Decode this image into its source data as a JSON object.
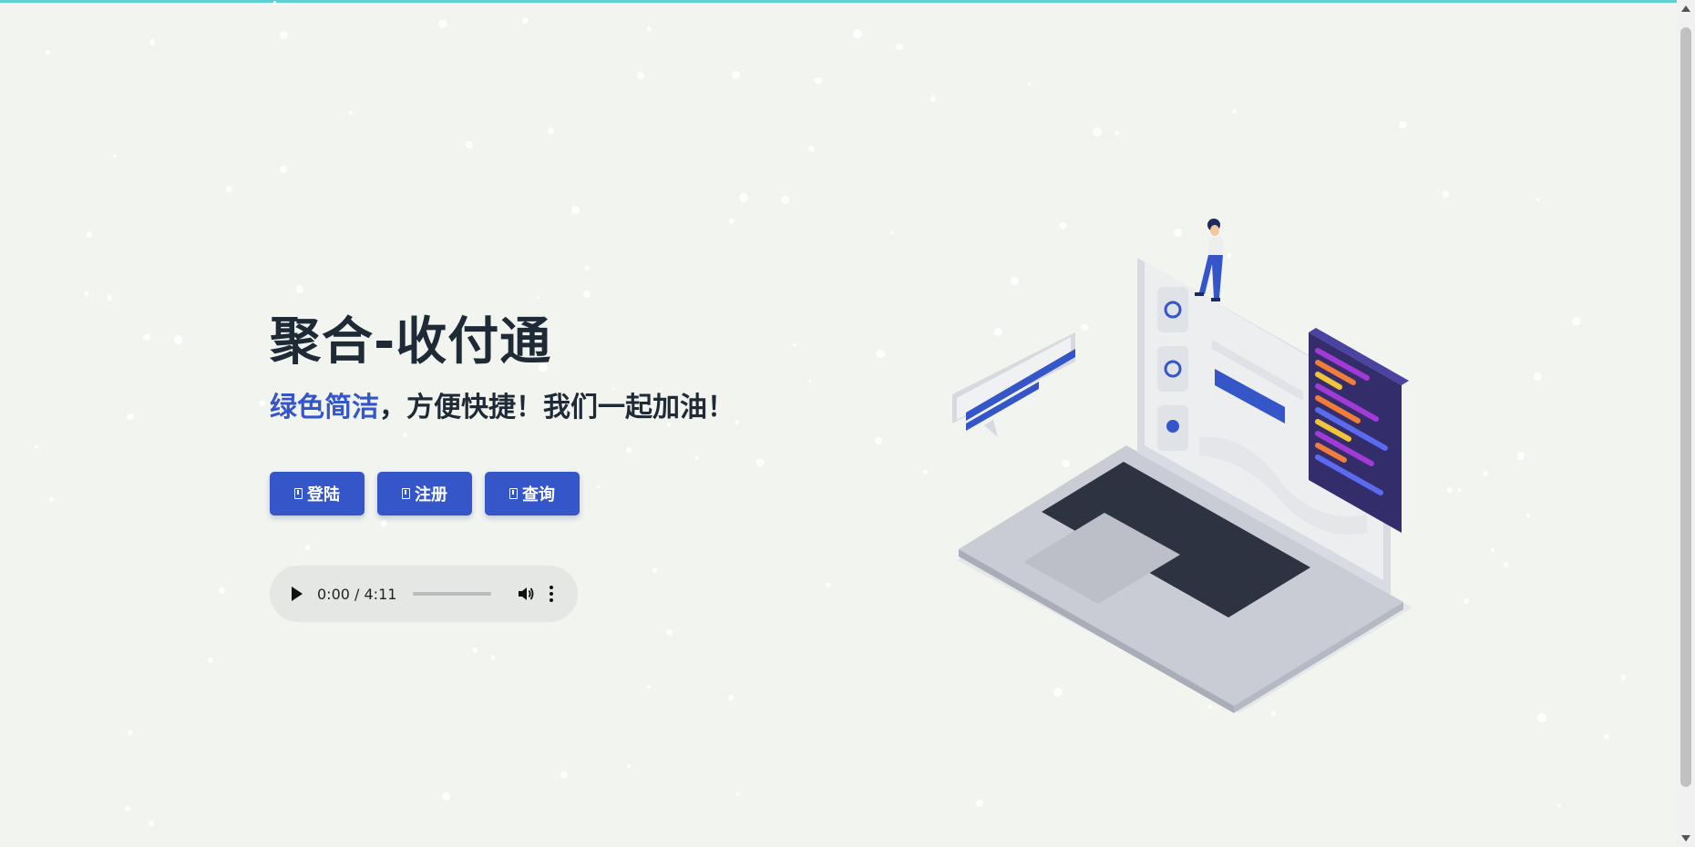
{
  "hero": {
    "title": "聚合-收付通",
    "subtitle_accent": "绿色简洁",
    "subtitle_rest": "，方便快捷！我们一起加油！"
  },
  "buttons": [
    {
      "label": "登陆",
      "icon": "file-icon"
    },
    {
      "label": "注册",
      "icon": "file-icon"
    },
    {
      "label": "查询",
      "icon": "file-icon"
    }
  ],
  "audio_player": {
    "time": "0:00 / 4:11",
    "progress": 0
  },
  "colors": {
    "background": "#f2f4ef",
    "accent": "#3556c9",
    "text": "#1f2a37",
    "top_bar": "#5fd0d2"
  }
}
